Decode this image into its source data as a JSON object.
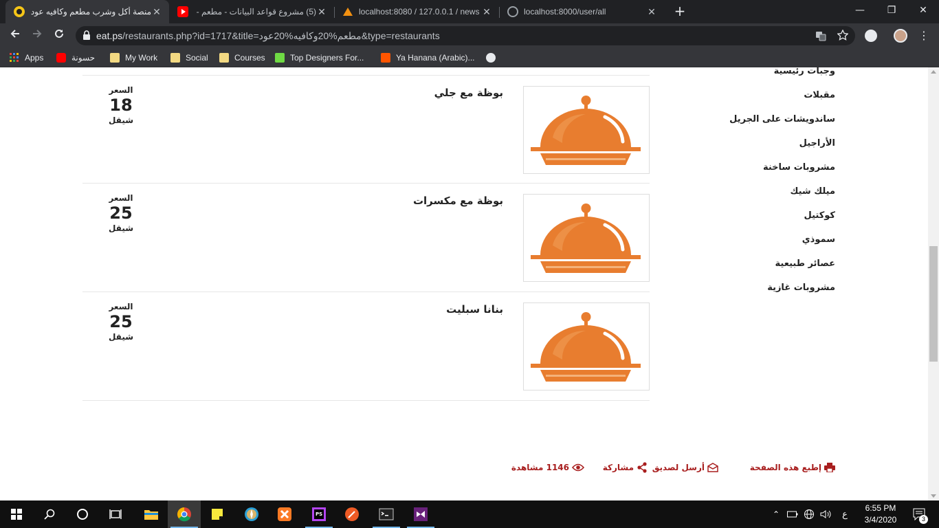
{
  "browser": {
    "tabs": [
      {
        "title": "منصة أكل وشرب مطعم وكافيه عود",
        "active": true
      },
      {
        "title": "(5) مشروع قواعد البيانات - مطعم -",
        "active": false
      },
      {
        "title": "localhost:8080 / 127.0.0.1 / news",
        "active": false
      },
      {
        "title": "localhost:8000/user/all",
        "active": false
      }
    ],
    "url_host": "eat.ps",
    "url_path": "/restaurants.php?id=1717&title=مطعم%20وكافيه%20عود&type=restaurants"
  },
  "bookmarks": [
    {
      "label": "Apps"
    },
    {
      "label": "حسونة"
    },
    {
      "label": "My Work"
    },
    {
      "label": "Social"
    },
    {
      "label": "Courses"
    },
    {
      "label": "Top Designers For..."
    },
    {
      "label": "Ya Hanana (Arabic)..."
    }
  ],
  "sidebar": {
    "items": [
      {
        "label": "وجبات رئيسية"
      },
      {
        "label": "مقبلات"
      },
      {
        "label": "ساندويشات على الجريل"
      },
      {
        "label": "الأراجيل"
      },
      {
        "label": "مشروبات ساخنة"
      },
      {
        "label": "ميلك شيك"
      },
      {
        "label": "كوكتيل"
      },
      {
        "label": "سموذي"
      },
      {
        "label": "عصائر طبيعية"
      },
      {
        "label": "مشروبات غازية"
      }
    ]
  },
  "menu": {
    "price_label": "السعر",
    "currency": "شيقل",
    "items": [
      {
        "name": "بوظة مع جلي",
        "price": "18"
      },
      {
        "name": "بوظة مع مكسرات",
        "price": "25"
      },
      {
        "name": "بنانا سبليت",
        "price": "25"
      }
    ]
  },
  "actions": {
    "print": "إطبع هذه الصفحة",
    "send": "أرسل لصديق",
    "share": "مشاركة",
    "views": "1146 مشاهدة"
  },
  "taskbar": {
    "time": "6:55 PM",
    "date": "3/4/2020",
    "lang": "ع",
    "notifications": "3"
  },
  "colors": {
    "accent": "#a81e1e",
    "food_icon": "#e87d2f"
  }
}
